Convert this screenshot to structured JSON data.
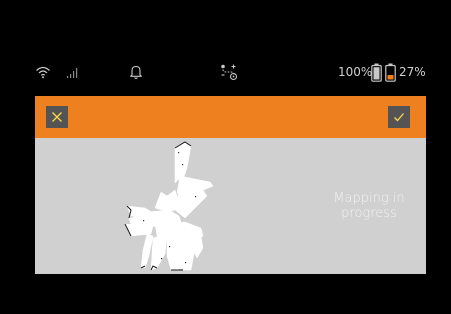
{
  "colors": {
    "background": "#000000",
    "header_accent": "#ef8020",
    "header_button": "#545454",
    "button_icon": "#ffd84a",
    "map_background": "#d0d0d0",
    "map_explored": "#ffffff",
    "status_icon": "#c8c8c8",
    "battery_low": "#ef8020"
  },
  "status_bar": {
    "icons": [
      "wifi-icon",
      "signal-bars-icon",
      "bell-icon",
      "robot-route-icon"
    ],
    "robot_battery": "100%",
    "phone_battery": "27%",
    "robot_battery_level": 1.0,
    "phone_battery_level": 0.27
  },
  "header": {
    "cancel_icon": "close-icon",
    "confirm_icon": "check-icon"
  },
  "map": {
    "status_line1": "Mapping in",
    "status_line2": "progress"
  }
}
